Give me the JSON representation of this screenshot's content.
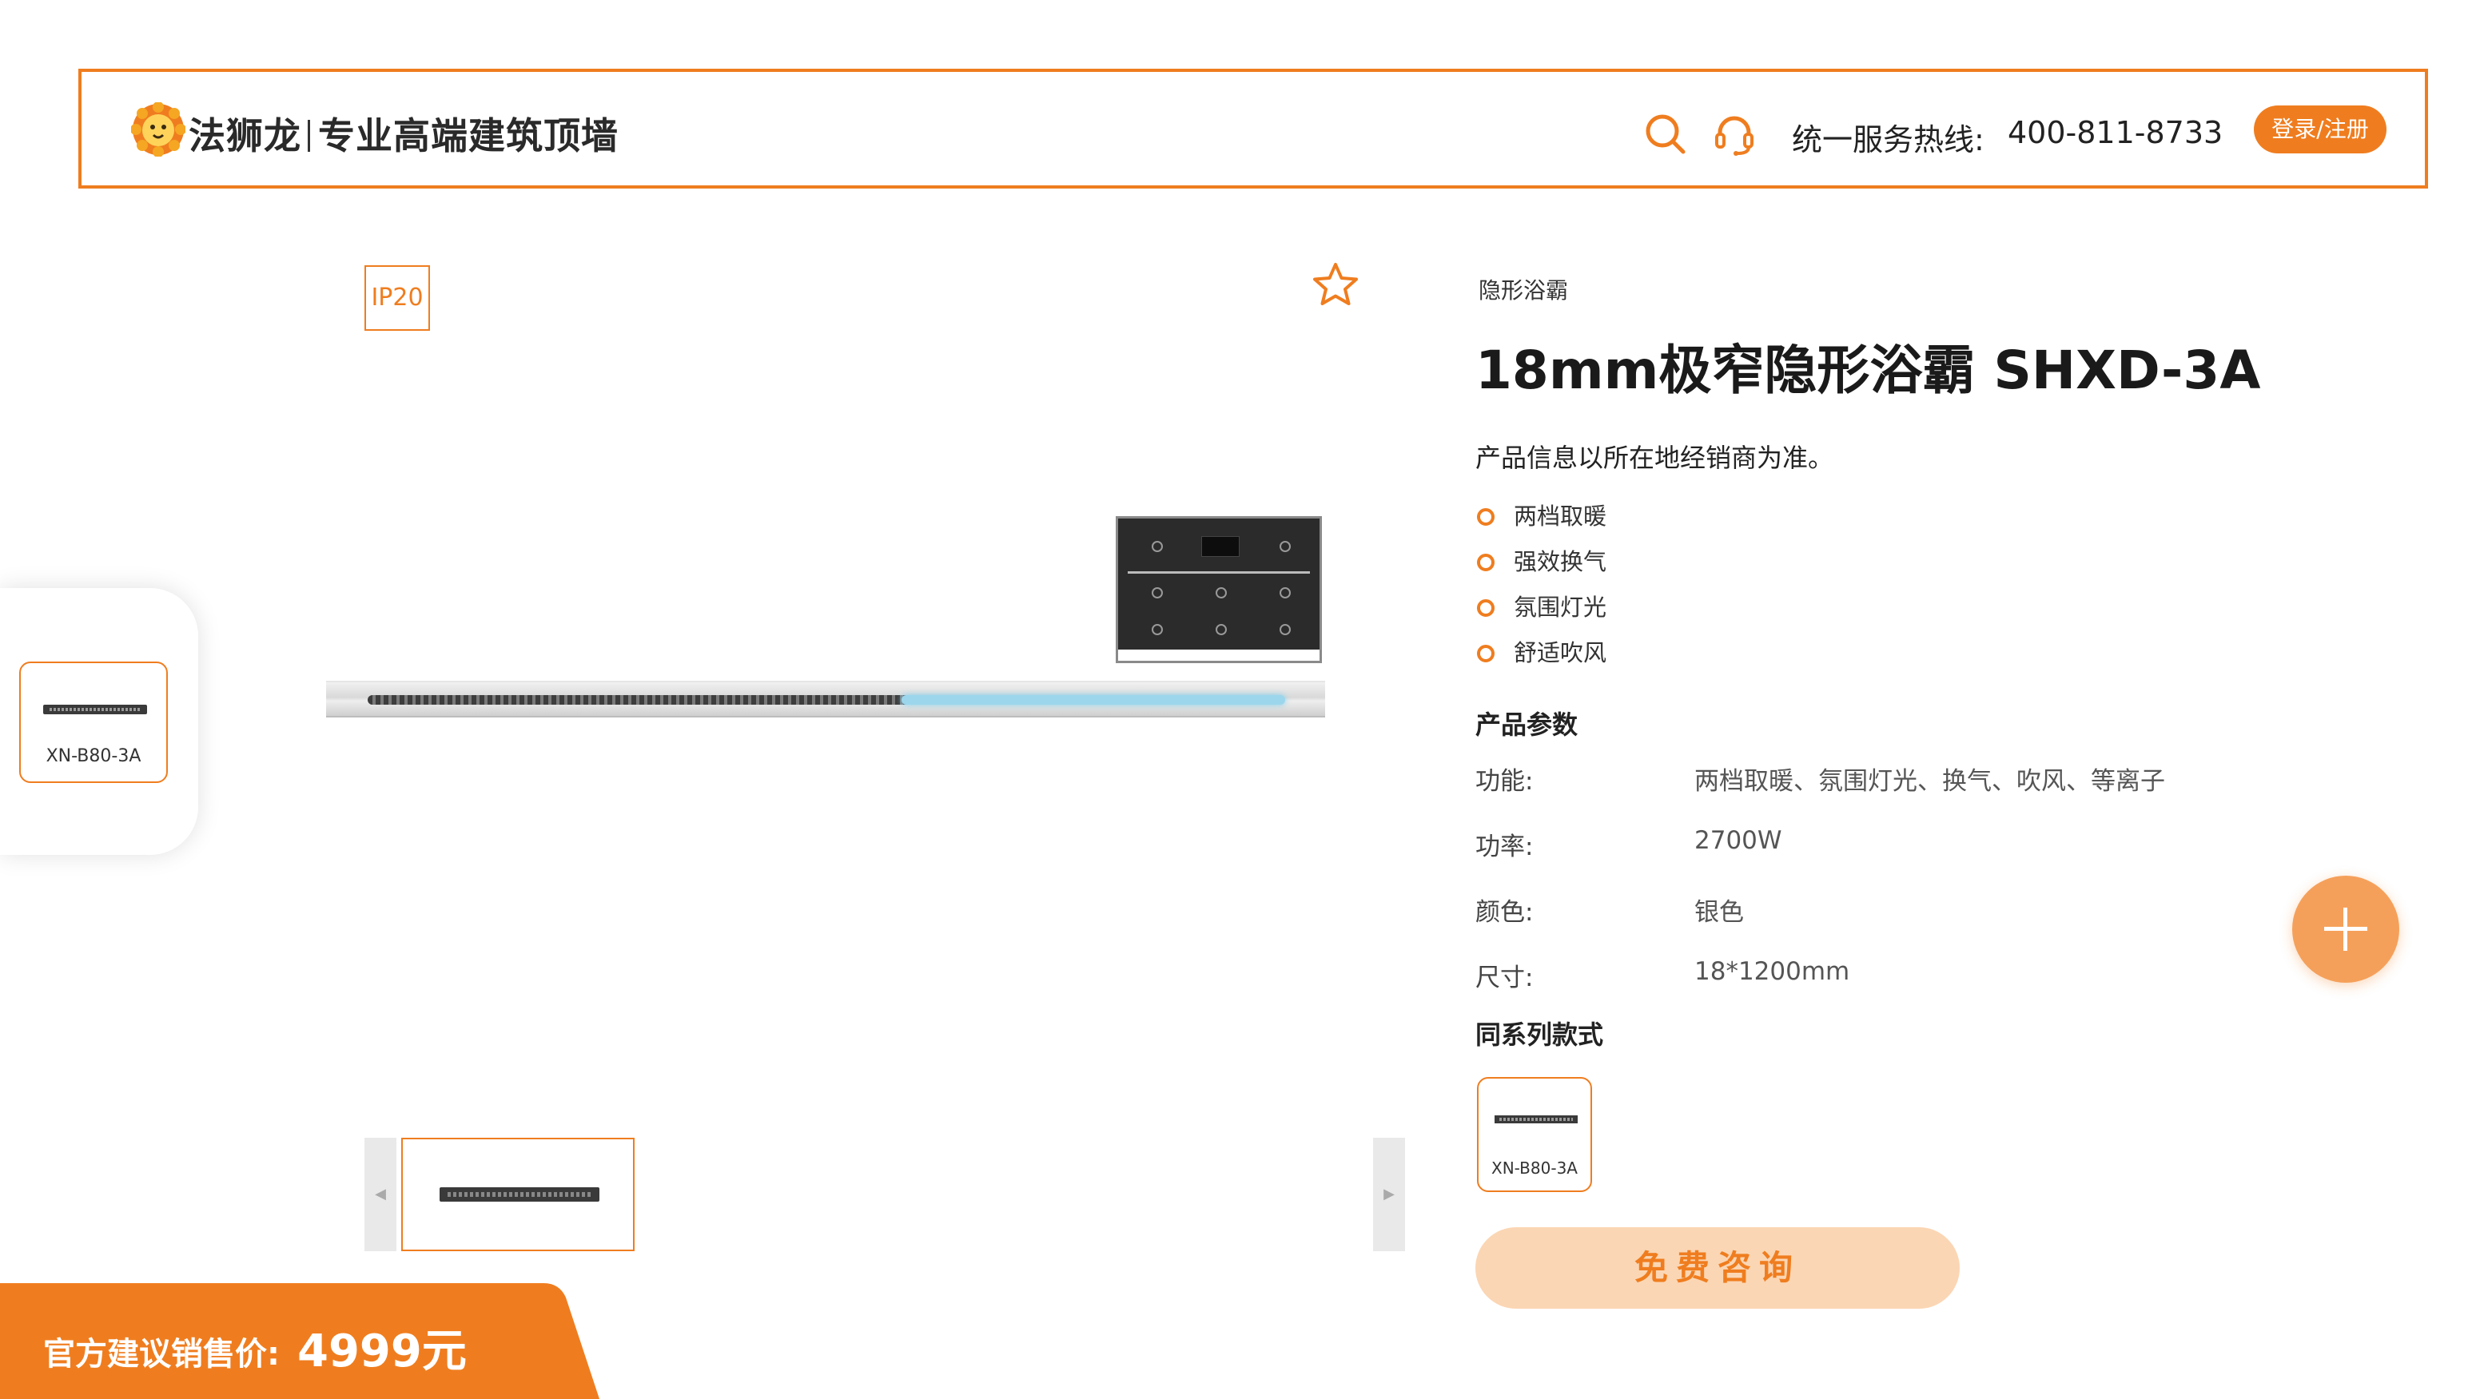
{
  "header": {
    "brand_name": "法狮龙",
    "slogan": "专业高端建筑顶墙",
    "hotline_label": "统一服务热线:",
    "hotline_number": "400-811-8733",
    "login_label": "登录/注册",
    "icons": [
      "lion-logo-icon",
      "search-icon",
      "headset-icon"
    ]
  },
  "gallery": {
    "badge": "IP20",
    "favorite_icon": "star-outline-icon",
    "thumb_prev_icon": "chevron-left-icon",
    "thumb_next_icon": "chevron-right-icon"
  },
  "float_card": {
    "item_label": "XN-B80-3A"
  },
  "product": {
    "category": "隐形浴霸",
    "title": "18mm极窄隐形浴霸 SHXD-3A",
    "note": "产品信息以所在地经销商为准。",
    "features": [
      "两档取暖",
      "强效换气",
      "氛围灯光",
      "舒适吹风"
    ],
    "params_title": "产品参数",
    "params": [
      {
        "label": "功能:",
        "value": "两档取暖、氛围灯光、换气、吹风、等离子"
      },
      {
        "label": "功率:",
        "value": "2700W"
      },
      {
        "label": "颜色:",
        "value": "银色"
      },
      {
        "label": "尺寸:",
        "value": "18*1200mm"
      }
    ],
    "series_title": "同系列款式",
    "series_items": [
      {
        "label": "XN-B80-3A"
      }
    ],
    "consult_label": "免费咨询"
  },
  "price": {
    "label": "官方建议销售价:",
    "value": "4999元"
  },
  "colors": {
    "accent": "#ef7d1f",
    "consult_bg": "#fbd6b4",
    "plus_bg": "#f5a05a"
  }
}
